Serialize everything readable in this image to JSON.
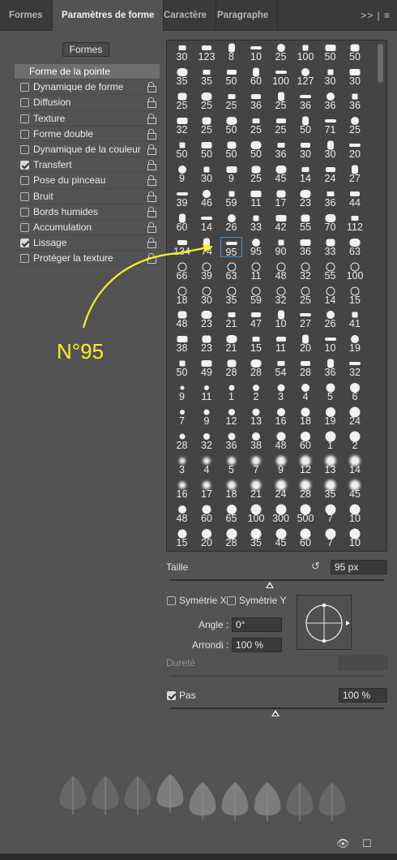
{
  "tabs": [
    {
      "label": "Formes",
      "active": false
    },
    {
      "label": "Paramètres de forme",
      "active": true
    },
    {
      "label": "Caractère",
      "active": false
    },
    {
      "label": "Paragraphe",
      "active": false
    }
  ],
  "tab_menu_icon": ">> | ≡",
  "presets_button": "Formes",
  "options": [
    {
      "label": "Forme de la pointe",
      "header": true
    },
    {
      "label": "Dynamique de forme",
      "checked": false,
      "lock": true
    },
    {
      "label": "Diffusion",
      "checked": false,
      "lock": true
    },
    {
      "label": "Texture",
      "checked": false,
      "lock": true
    },
    {
      "label": "Forme double",
      "checked": false,
      "lock": true
    },
    {
      "label": "Dynamique de la couleur",
      "checked": false,
      "lock": true
    },
    {
      "label": "Transfert",
      "checked": true,
      "lock": true
    },
    {
      "label": "Pose du pinceau",
      "checked": false,
      "lock": true
    },
    {
      "label": "Bruit",
      "checked": false,
      "lock": true
    },
    {
      "label": "Bords humides",
      "checked": false,
      "lock": true
    },
    {
      "label": "Accumulation",
      "checked": false,
      "lock": true
    },
    {
      "label": "Lissage",
      "checked": true,
      "lock": true
    },
    {
      "label": "Protéger la texture",
      "checked": false,
      "lock": true
    }
  ],
  "brush_sizes": [
    "30",
    "123",
    "8",
    "10",
    "25",
    "100",
    "50",
    "50",
    "35",
    "35",
    "50",
    "60",
    "100",
    "127",
    "30",
    "30",
    "25",
    "25",
    "25",
    "36",
    "25",
    "36",
    "36",
    "36",
    "32",
    "25",
    "50",
    "25",
    "25",
    "50",
    "71",
    "25",
    "50",
    "50",
    "50",
    "50",
    "36",
    "30",
    "30",
    "20",
    "9",
    "30",
    "9",
    "25",
    "45",
    "14",
    "24",
    "27",
    "39",
    "46",
    "59",
    "11",
    "17",
    "23",
    "36",
    "44",
    "60",
    "14",
    "26",
    "33",
    "42",
    "55",
    "70",
    "112",
    "134",
    "74",
    "95",
    "95",
    "90",
    "36",
    "33",
    "63",
    "66",
    "39",
    "63",
    "11",
    "48",
    "32",
    "55",
    "100",
    "18",
    "30",
    "35",
    "59",
    "32",
    "25",
    "14",
    "15",
    "48",
    "23",
    "21",
    "47",
    "10",
    "27",
    "26",
    "41",
    "38",
    "23",
    "21",
    "15",
    "11",
    "20",
    "10",
    "19",
    "50",
    "49",
    "28",
    "28",
    "54",
    "28",
    "36",
    "32",
    "9",
    "11",
    "1",
    "2",
    "3",
    "4",
    "5",
    "6",
    "7",
    "9",
    "12",
    "13",
    "16",
    "18",
    "19",
    "24",
    "28",
    "32",
    "36",
    "38",
    "48",
    "60",
    "1",
    "2",
    "3",
    "4",
    "5",
    "7",
    "9",
    "12",
    "13",
    "14",
    "16",
    "17",
    "18",
    "21",
    "24",
    "28",
    "35",
    "45",
    "48",
    "60",
    "65",
    "100",
    "300",
    "500",
    "7",
    "10",
    "15",
    "20",
    "28",
    "35",
    "45",
    "60",
    "7",
    "10"
  ],
  "selected_brush_index": 66,
  "annotation": "N°95",
  "size": {
    "label": "Taille",
    "value": "95 px",
    "slider": 0.33
  },
  "flip_x": {
    "label": "Symétrie X",
    "checked": false
  },
  "flip_y": {
    "label": "Symétrie Y",
    "checked": false
  },
  "angle": {
    "label": "Angle :",
    "value": "0°"
  },
  "roundness": {
    "label": "Arrondi :",
    "value": "100 %"
  },
  "hardness": {
    "label": "Dureté"
  },
  "spacing": {
    "label": "Pas",
    "checked": true,
    "value": "100 %",
    "slider": 0.5
  },
  "colors": {
    "accent_selection": "#3c94d6",
    "annotation": "#f7f029",
    "panel": "#535353"
  },
  "footer_icons": [
    "eye-brush-icon",
    "new-preset-icon"
  ]
}
